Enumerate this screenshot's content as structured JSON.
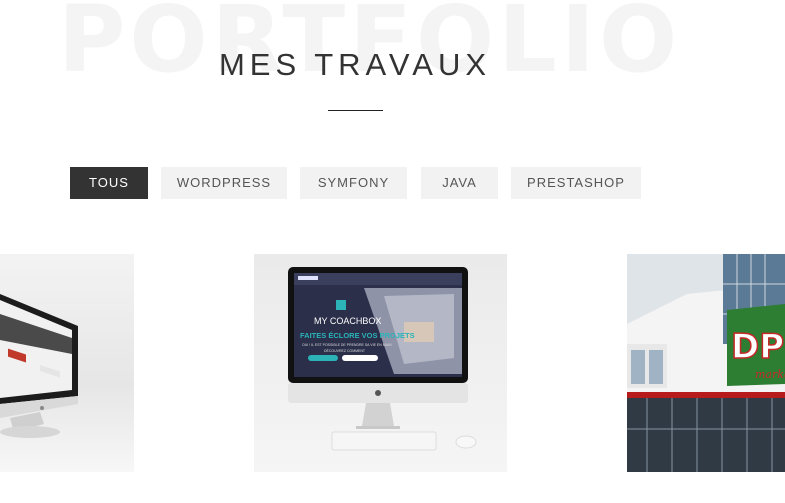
{
  "section": {
    "watermark": "PORTFOLIO",
    "title": "MES TRAVAUX"
  },
  "filters": [
    {
      "label": "TOUS",
      "active": true
    },
    {
      "label": "WORDPRESS",
      "active": false
    },
    {
      "label": "SYMFONY",
      "active": false
    },
    {
      "label": "JAVA",
      "active": false
    },
    {
      "label": "PRESTASHOP",
      "active": false
    }
  ],
  "projects": [
    {
      "name": "imac-website-mockup"
    },
    {
      "name": "my-coachbox-mockup",
      "logo": "MY COACHBOX",
      "headline": "FAITES ÉCLORE VOS PROJETS",
      "subtext": "OUI ! IL EST POSSIBLE DE PRENDRE SA VIE EN MAIN",
      "subtext2": "DÉCOUVREZ COMMENT",
      "btn1": "",
      "btn2": ""
    },
    {
      "name": "dps-market-storefront",
      "sign": "DPS",
      "sign2": "market"
    }
  ],
  "colors": {
    "accent": "#333333",
    "filter_bg": "#f2f2f2",
    "coach_teal": "#2bb3b8"
  }
}
